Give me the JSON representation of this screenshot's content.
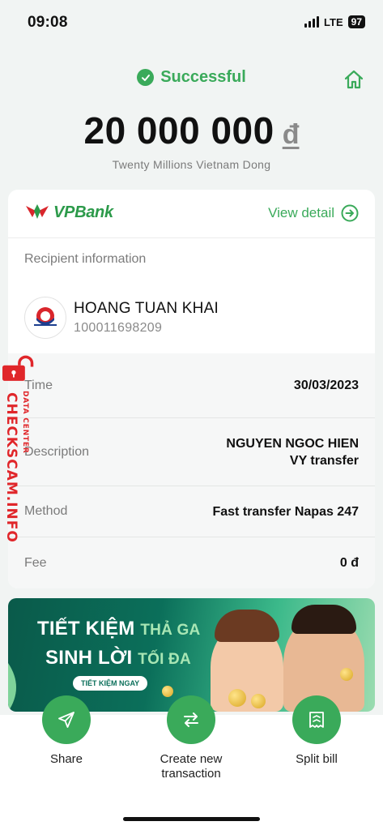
{
  "status_bar": {
    "time": "09:08",
    "network": "LTE",
    "battery": "97"
  },
  "header": {
    "status_text": "Successful",
    "amount": "20 000 000",
    "currency": "đ",
    "amount_words": "Twenty Millions Vietnam Dong"
  },
  "card": {
    "bank_name": "VPBank",
    "view_detail_label": "View detail",
    "recipient_label": "Recipient information",
    "recipient_name": "HOANG TUAN KHAI",
    "recipient_account": "100011698209",
    "details": [
      {
        "label": "Time",
        "value": "30/03/2023"
      },
      {
        "label": "Description",
        "value_line1": "NGUYEN NGOC HIEN",
        "value_line2": "VY transfer"
      },
      {
        "label": "Method",
        "value": "Fast transfer Napas 247"
      },
      {
        "label": "Fee",
        "value": "0 đ"
      }
    ]
  },
  "banner": {
    "line1_big": "TIẾT KIỆM",
    "line1_small": "THẢ GA",
    "line2_big": "SINH LỜI",
    "line2_small": "TỐI ĐA",
    "button": "TIẾT KIỆM NGAY"
  },
  "actions": [
    {
      "label": "Share",
      "icon": "send-icon"
    },
    {
      "label": "Create new transaction",
      "icon": "swap-arrows-icon"
    },
    {
      "label": "Split bill",
      "icon": "split-bill-icon"
    }
  ],
  "watermark": {
    "main": "CHECKSCAM.INFO",
    "sub": "DATA CENTER"
  },
  "colors": {
    "accent": "#3aaa5a",
    "watermark": "#e0262a"
  }
}
